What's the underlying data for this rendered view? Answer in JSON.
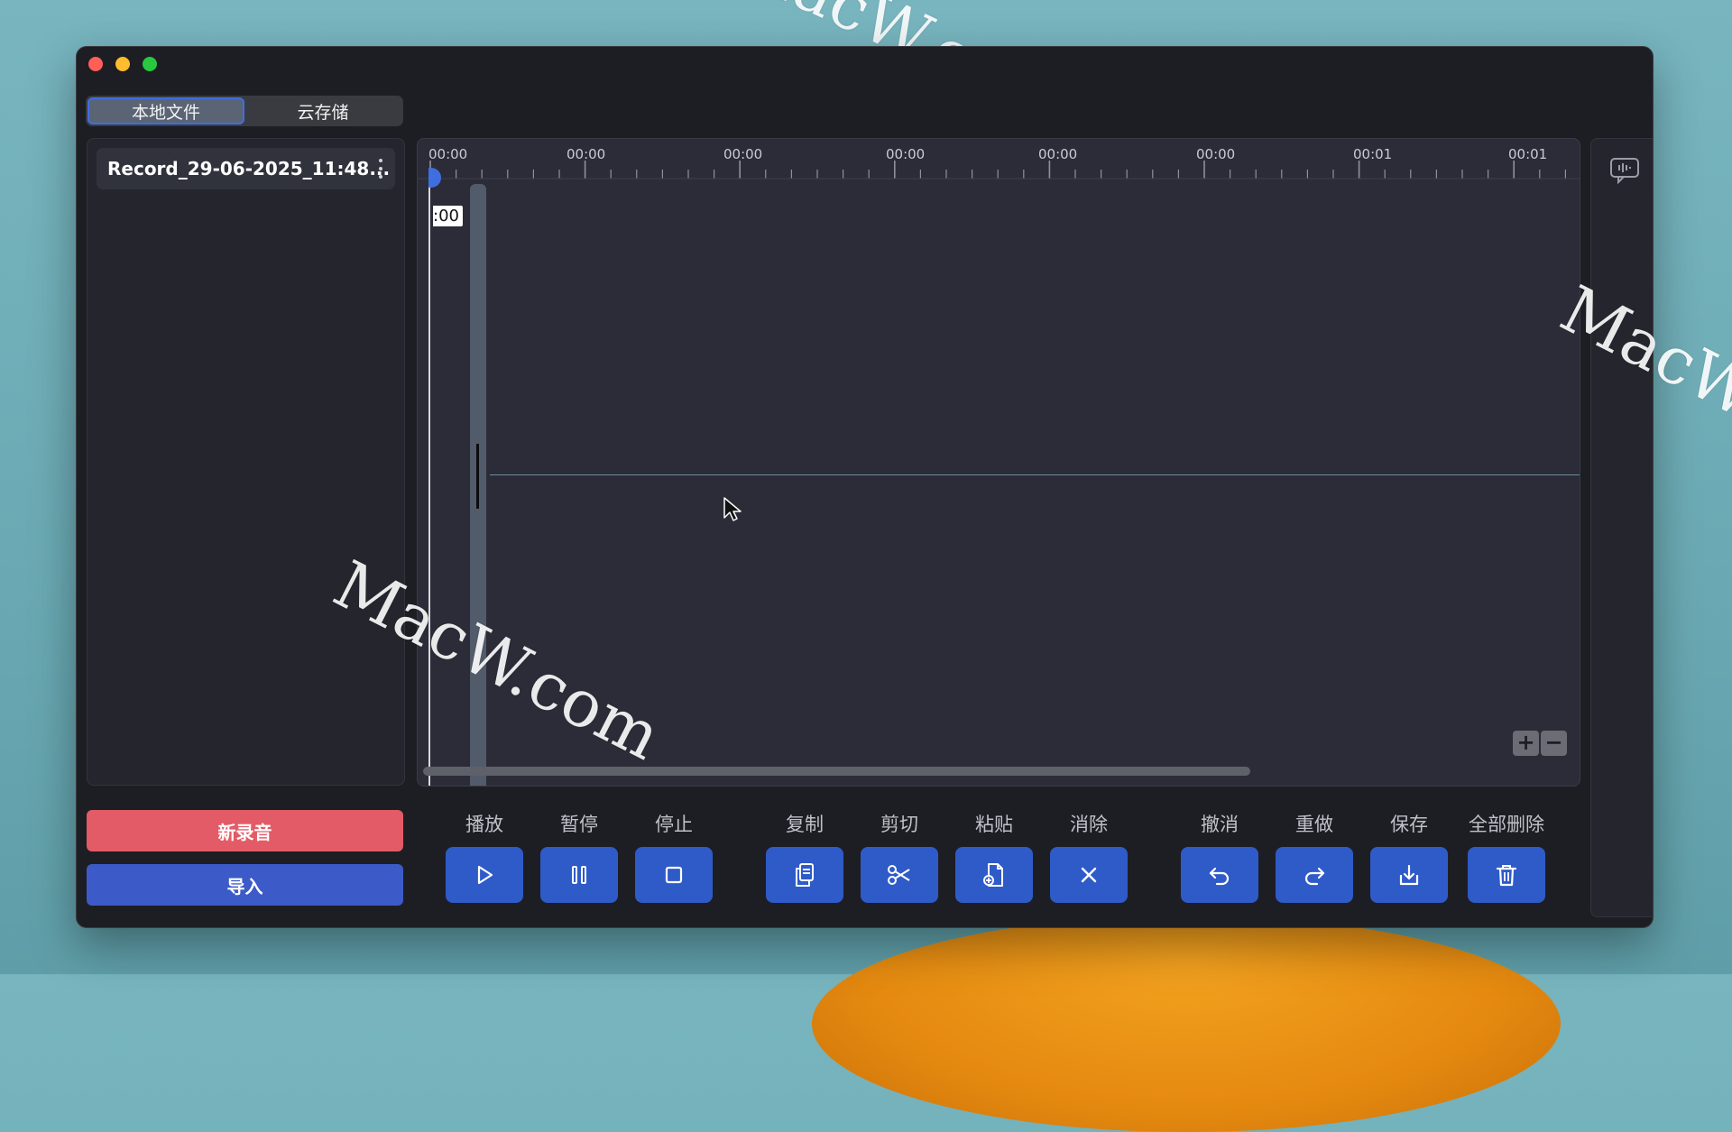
{
  "watermark": "MacW.com",
  "tabs": [
    {
      "label": "本地文件",
      "active": true
    },
    {
      "label": "云存储",
      "active": false
    }
  ],
  "files": [
    {
      "name": "Record_29-06-2025_11:48..."
    }
  ],
  "ruler": {
    "labels": [
      "00:00",
      "00:00",
      "00:00",
      "00:00",
      "00:00",
      "00:00",
      "00:01",
      "00:01"
    ]
  },
  "playhead": {
    "time_text": ":00"
  },
  "zoom": {
    "plus": "+",
    "minus": "−"
  },
  "actions": {
    "new_recording": "新录音",
    "import": "导入"
  },
  "toolbar": [
    {
      "label": "播放",
      "icon": "play-icon"
    },
    {
      "label": "暂停",
      "icon": "pause-icon"
    },
    {
      "label": "停止",
      "icon": "stop-icon"
    },
    {
      "label": "复制",
      "icon": "copy-icon"
    },
    {
      "label": "剪切",
      "icon": "scissors-icon"
    },
    {
      "label": "粘贴",
      "icon": "paste-icon"
    },
    {
      "label": "消除",
      "icon": "close-icon"
    },
    {
      "label": "撤消",
      "icon": "undo-icon"
    },
    {
      "label": "重做",
      "icon": "redo-icon"
    },
    {
      "label": "保存",
      "icon": "download-icon"
    },
    {
      "label": "全部删除",
      "icon": "trash-icon"
    }
  ],
  "colors": {
    "record": "#e35b66",
    "import": "#3c5bc8",
    "tool_button": "#2f5bc9",
    "accent": "#3f6fde"
  }
}
